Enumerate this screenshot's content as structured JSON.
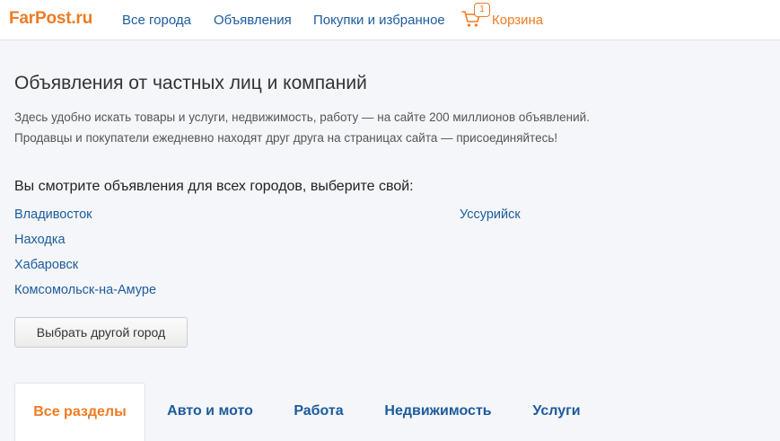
{
  "header": {
    "logo": "FarPost.ru",
    "nav": [
      {
        "label": "Все города"
      },
      {
        "label": "Объявления"
      },
      {
        "label": "Покупки и избранное"
      }
    ],
    "cart": {
      "count": "1",
      "label": "Корзина",
      "icon": "cart-icon"
    }
  },
  "main": {
    "title": "Объявления от частных лиц и компаний",
    "intro_line1": "Здесь удобно искать товары и услуги, недвижимость, работу — на сайте 200 миллионов объявлений.",
    "intro_line2": "Продавцы и покупатели ежедневно находят друг друга на страницах сайта — присоединяйтесь!",
    "choose_city": "Вы смотрите объявления для всех городов, выберите свой:",
    "cities_left": [
      "Владивосток",
      "Находка",
      "Хабаровск",
      "Комсомольск-на-Амуре"
    ],
    "cities_right": [
      "Уссурийск"
    ],
    "other_city_button": "Выбрать другой город"
  },
  "tabs": [
    {
      "label": "Все разделы",
      "active": true
    },
    {
      "label": "Авто и мото"
    },
    {
      "label": "Работа"
    },
    {
      "label": "Недвижимость"
    },
    {
      "label": "Услуги"
    }
  ],
  "colors": {
    "brand_orange": "#ef7b22",
    "link_blue": "#1d5b9e",
    "page_bg": "#f4f6f9"
  }
}
